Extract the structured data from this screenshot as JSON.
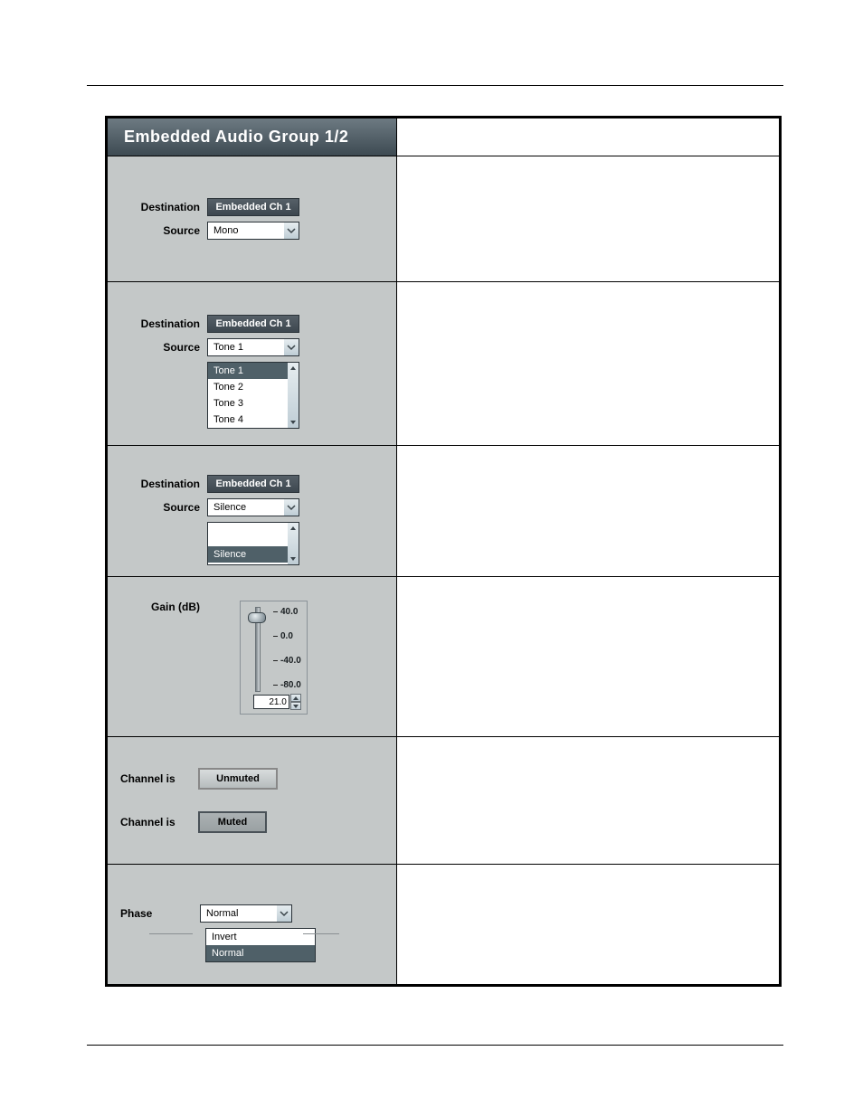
{
  "header_title": "Embedded Audio Group 1/2",
  "labels": {
    "destination": "Destination",
    "source": "Source",
    "gain": "Gain (dB)",
    "channel_is": "Channel is",
    "phase": "Phase"
  },
  "row1": {
    "dest_value": "Embedded Ch 1",
    "source_value": "Mono"
  },
  "row2": {
    "dest_value": "Embedded Ch 1",
    "source_value": "Tone 1",
    "options": [
      "Tone 1",
      "Tone 2",
      "Tone 3",
      "Tone 4"
    ],
    "selected_index": 0
  },
  "row3": {
    "dest_value": "Embedded Ch 1",
    "source_value": "Silence",
    "options": [
      "Silence"
    ],
    "selected_index": 0
  },
  "row4": {
    "ticks": [
      "40.0",
      "0.0",
      "-40.0",
      "-80.0"
    ],
    "spin_value": "21.0"
  },
  "row5": {
    "unmuted_label": "Unmuted",
    "muted_label": "Muted"
  },
  "row6": {
    "phase_value": "Normal",
    "options": [
      "Invert",
      "Normal"
    ],
    "selected_index": 1
  }
}
